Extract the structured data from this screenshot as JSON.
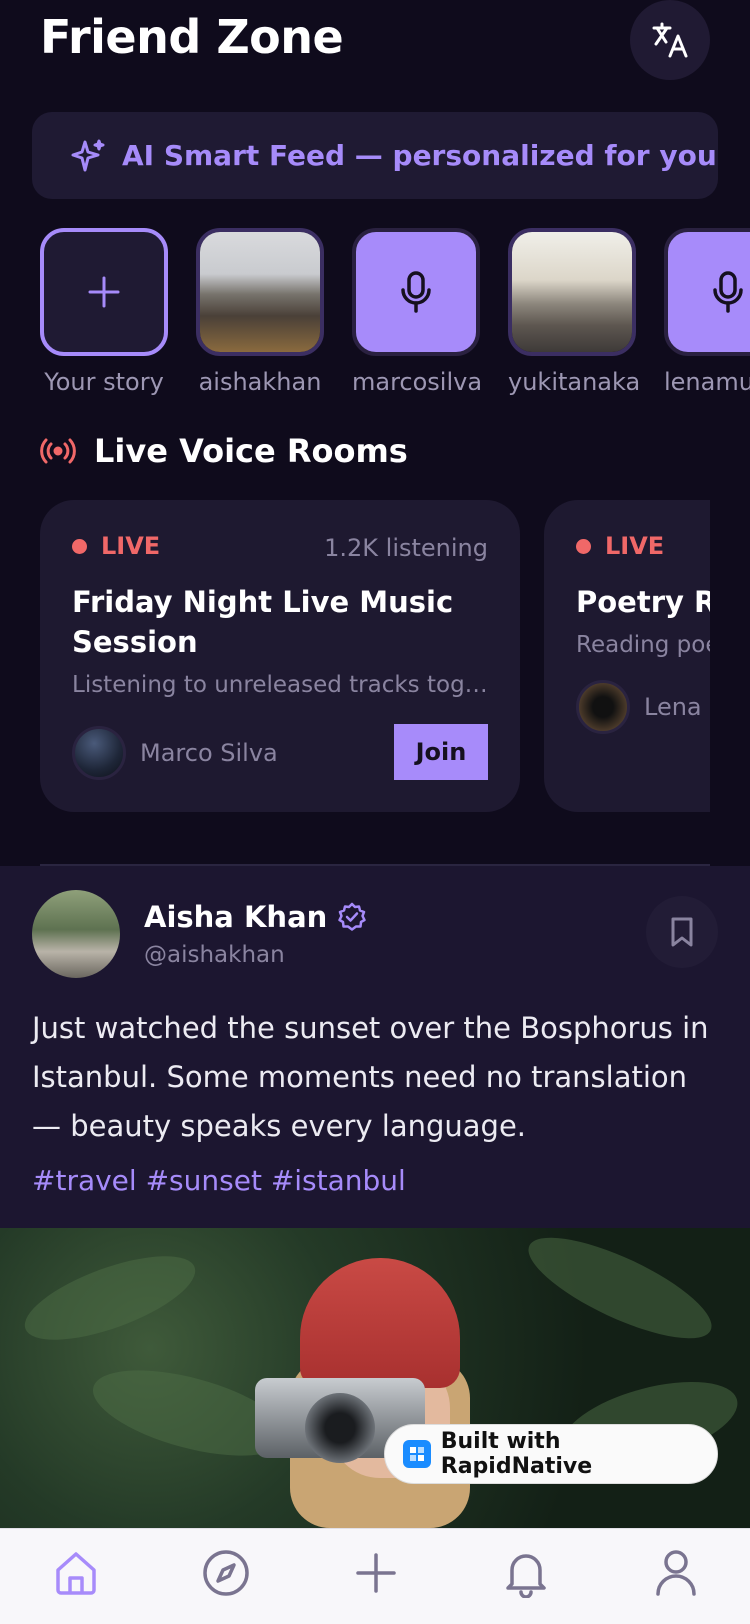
{
  "header": {
    "title": "Friend Zone",
    "translate_icon": "translate-icon"
  },
  "ai_banner": {
    "icon": "sparkle-icon",
    "label": "AI Smart Feed — personalized for you"
  },
  "stories": [
    {
      "name": "Your story",
      "kind": "add"
    },
    {
      "name": "aishakhan",
      "kind": "photo"
    },
    {
      "name": "marcosilva",
      "kind": "voice"
    },
    {
      "name": "yukitanaka",
      "kind": "photo"
    },
    {
      "name": "lenamu",
      "kind": "voice"
    }
  ],
  "live": {
    "section_title": "Live Voice Rooms",
    "icon": "broadcast-icon",
    "rooms": [
      {
        "badge": "LIVE",
        "listening": "1.2K listening",
        "title": "Friday Night Live Music Session",
        "description": "Listening to unreleased tracks toge...",
        "host": "Marco Silva",
        "join_label": "Join"
      },
      {
        "badge": "LIVE",
        "listening": "",
        "title": "Poetry Re",
        "description": "Reading poe",
        "host": "Lena M",
        "join_label": ""
      }
    ]
  },
  "post": {
    "author": "Aisha Khan",
    "handle": "@aishakhan",
    "verified": true,
    "text": "Just watched the sunset over the Bosphorus in Istanbul. Some moments need no translation — beauty speaks every language.",
    "tags": "#travel #sunset #istanbul"
  },
  "badge": {
    "label": "Built with RapidNative"
  },
  "bottom_nav": [
    {
      "icon": "home-icon",
      "active": true
    },
    {
      "icon": "compass-icon",
      "active": false
    },
    {
      "icon": "plus-icon",
      "active": false
    },
    {
      "icon": "bell-icon",
      "active": false
    },
    {
      "icon": "profile-icon",
      "active": false
    }
  ],
  "colors": {
    "background": "#0f0b1c",
    "accent": "#a78bfa",
    "live": "#f06868",
    "card": "#1e1930"
  }
}
